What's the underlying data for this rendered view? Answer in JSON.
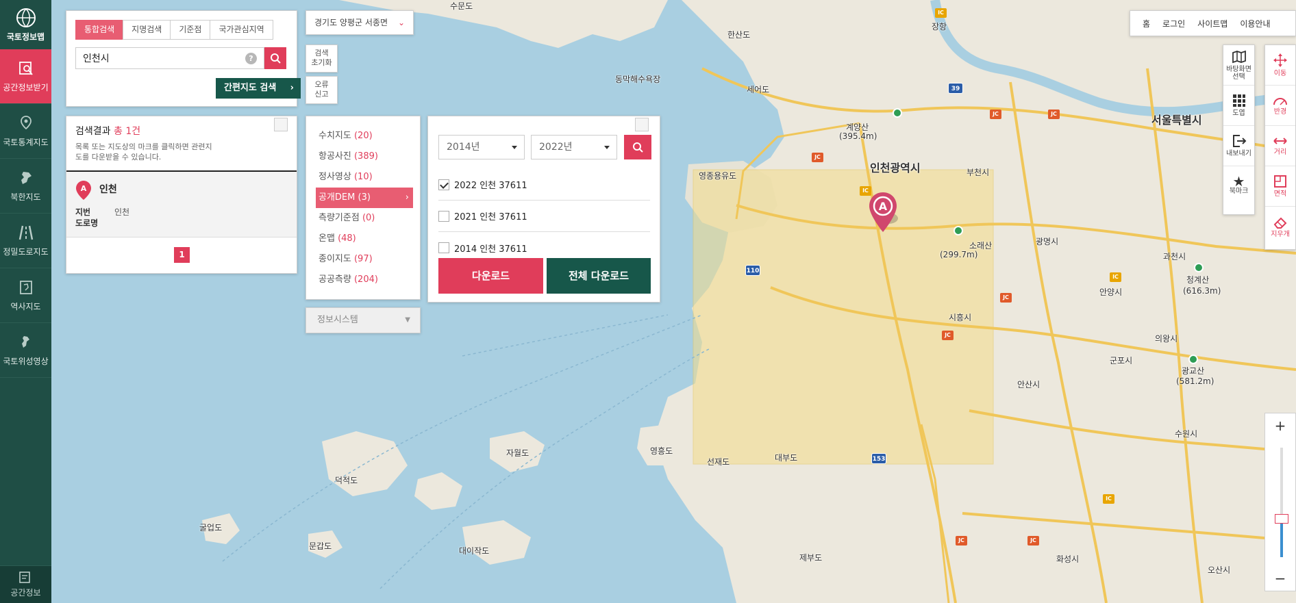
{
  "sidebar": {
    "logo_label": "국토정보맵",
    "items": [
      {
        "label": "공간정보받기",
        "icon": "map-search-icon",
        "active": true
      },
      {
        "label": "국토통계지도",
        "icon": "map-pin-icon",
        "active": false
      },
      {
        "label": "북한지도",
        "icon": "north-korea-icon",
        "active": false
      },
      {
        "label": "정밀도로지도",
        "icon": "road-icon",
        "active": false
      },
      {
        "label": "역사지도",
        "icon": "history-map-icon",
        "active": false
      },
      {
        "label": "국토위성영상",
        "icon": "satellite-icon",
        "active": false
      }
    ],
    "bottom_label": "공간정보"
  },
  "search": {
    "tabs": [
      "통합검색",
      "지명검색",
      "기준점",
      "국가관심지역"
    ],
    "active_tab": "통합검색",
    "query": "인천시",
    "help_label": "?",
    "simple_search_label": "간편지도 검색"
  },
  "region_select": "경기도 양평군 서종면",
  "side_buttons": {
    "reset": [
      "검색",
      "초기화"
    ],
    "report": [
      "오류",
      "신고"
    ]
  },
  "results": {
    "title": "검색결과",
    "count_text": "총 1건",
    "desc": "목록 또는 지도상의 마크를 클릭하면 관련지도를 다운받을 수 있습니다.",
    "item": {
      "marker": "A",
      "name": "인천",
      "jibun_label": "지번",
      "jibun_value": "인천",
      "road_label": "도로명",
      "road_value": ""
    },
    "page": "1"
  },
  "categories": [
    {
      "name": "수치지도",
      "count": "(20)",
      "active": false
    },
    {
      "name": "항공사진",
      "count": "(389)",
      "active": false
    },
    {
      "name": "정사영상",
      "count": "(10)",
      "active": false
    },
    {
      "name": "공개DEM",
      "count": "(3)",
      "active": true
    },
    {
      "name": "측량기준점",
      "count": "(0)",
      "active": false
    },
    {
      "name": "온맵",
      "count": "(48)",
      "active": false
    },
    {
      "name": "종이지도",
      "count": "(97)",
      "active": false
    },
    {
      "name": "공공측량",
      "count": "(204)",
      "active": false
    }
  ],
  "info_system_select": "정보시스템",
  "download": {
    "year_from": "2014년",
    "year_to": "2022년",
    "rows": [
      {
        "label": "2022 인천 37611",
        "checked": true
      },
      {
        "label": "2021 인천 37611",
        "checked": false
      },
      {
        "label": "2014 인천 37611",
        "checked": false
      }
    ],
    "download_label": "다운로드",
    "download_all_label": "전체 다운로드"
  },
  "top_nav": [
    "홈",
    "로그인",
    "사이트맵",
    "이용안내"
  ],
  "tools_left": [
    {
      "label": "바탕화면 선택",
      "icon": "base-map-icon"
    },
    {
      "label": "도엽",
      "icon": "grid-icon"
    },
    {
      "label": "내보내기",
      "icon": "export-icon"
    },
    {
      "label": "북마크",
      "icon": "star-icon"
    }
  ],
  "tools_right": [
    {
      "label": "이동",
      "icon": "move-icon"
    },
    {
      "label": "반경",
      "icon": "radius-icon"
    },
    {
      "label": "거리",
      "icon": "distance-icon"
    },
    {
      "label": "면적",
      "icon": "area-icon"
    },
    {
      "label": "지우개",
      "icon": "eraser-icon"
    }
  ],
  "zoom": {
    "plus": "+",
    "minus": "−",
    "level_fraction": 0.35
  },
  "map": {
    "marker": "A",
    "labels": {
      "incheon": "인천광역시",
      "seoul": "서울특별시",
      "gyeyangsan": "계양산",
      "gyeyangsan_h": "(395.4m)",
      "soraesan": "소래산",
      "soraesan_h": "(299.7m)",
      "cheonggyesan": "청계산",
      "cheonggyesan_h": "(616.3m)",
      "gwanggyosan": "광교산",
      "gwanggyosan_h": "(581.2m)",
      "gwangmyeong": "광명시",
      "bucheon": "부천시",
      "siheung": "시흥시",
      "ansan": "안산시",
      "gunpo": "군포시",
      "anyang": "안양시",
      "uiwang": "의왕시",
      "gwacheon": "과천시",
      "suwon": "수원시",
      "hwaseong": "화성시",
      "osan": "오산시",
      "deokjeokdo": "덕적도",
      "jawoldo": "자월도",
      "yeongheungdo": "영흥도",
      "seonjaedo": "선재도",
      "daebudo": "대부도",
      "jebudo": "제부도",
      "gureopdo": "굴업도",
      "mungapdo": "문갑도",
      "daeijakdo": "대이작도",
      "sewol": "세어도",
      "yeongjong": "영종용유도",
      "hangang": "한산도",
      "gangchon": "장항",
      "damak": "동막해수욕장",
      "sumun": "수문도"
    }
  },
  "colors": {
    "accent": "#e03d5a",
    "dark_green": "#17574a",
    "sidebar": "#1f4e45",
    "sea": "#a9cfe1",
    "land": "#ece8dd",
    "highlight": "#f4dfa0"
  }
}
